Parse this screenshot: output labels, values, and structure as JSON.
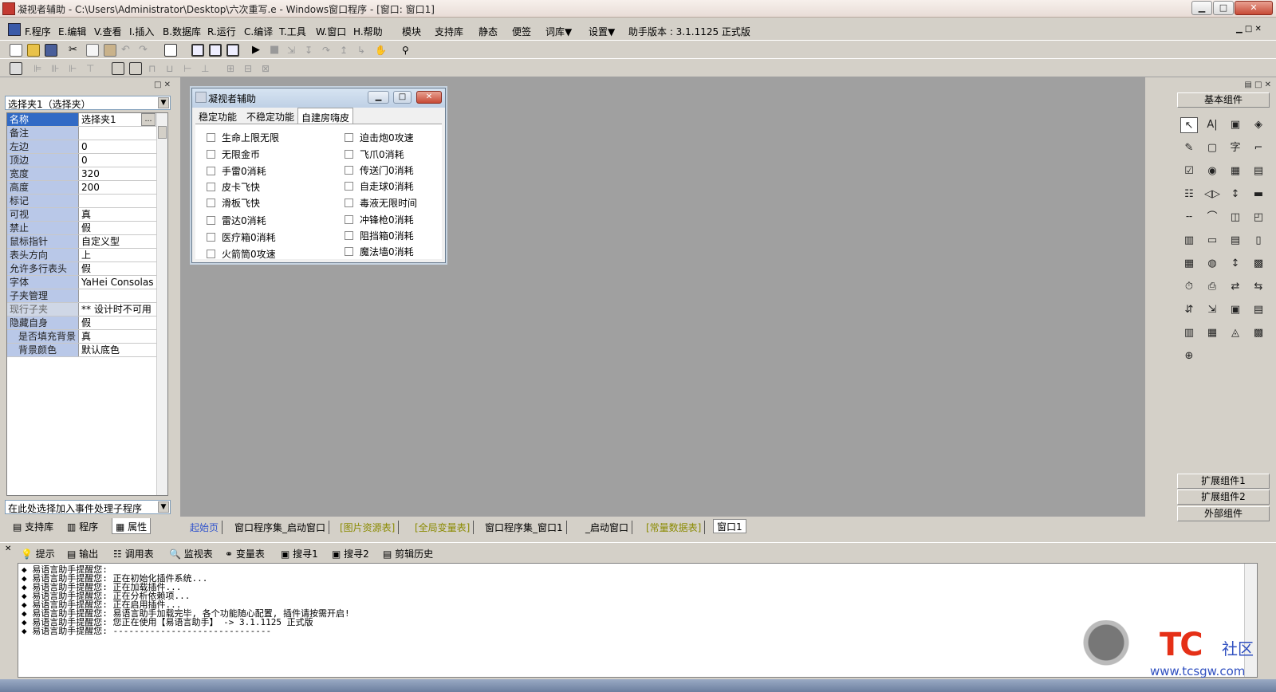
{
  "window": {
    "title": "凝视者辅助 - C:\\Users\\Administrator\\Desktop\\六次重写.e - Windows窗口程序 - [窗口: 窗口1]",
    "min": "▁",
    "max": "□",
    "close": "✕"
  },
  "menu": {
    "items": [
      "F.程序",
      "E.编辑",
      "V.查看",
      "I.插入",
      "B.数据库",
      "R.运行",
      "C.编译",
      "T.工具",
      "W.窗口",
      "H.帮助",
      "模块",
      "支持库",
      "静态",
      "便签",
      "词库▼",
      "设置▼"
    ],
    "version": "助手版本 : 3.1.1125 正式版"
  },
  "left_panel": {
    "selector": "选择夹1（选择夹）",
    "properties": [
      {
        "name": "名称",
        "value": "选择夹1",
        "selected": true
      },
      {
        "name": "备注",
        "value": ""
      },
      {
        "name": "左边",
        "value": "0"
      },
      {
        "name": "顶边",
        "value": "0"
      },
      {
        "name": "宽度",
        "value": "320"
      },
      {
        "name": "高度",
        "value": "200"
      },
      {
        "name": "标记",
        "value": ""
      },
      {
        "name": "可视",
        "value": "真"
      },
      {
        "name": "禁止",
        "value": "假"
      },
      {
        "name": "鼠标指针",
        "value": "自定义型"
      },
      {
        "name": "表头方向",
        "value": "上"
      },
      {
        "name": "允许多行表头",
        "value": "假"
      },
      {
        "name": "字体",
        "value": "YaHei Consolas H"
      },
      {
        "name": "子夹管理",
        "value": ""
      },
      {
        "name": "现行子夹",
        "value": "** 设计时不可用",
        "gray": true
      },
      {
        "name": "隐藏自身",
        "value": "假"
      },
      {
        "name": "是否填充背景",
        "value": "真",
        "sub": true
      },
      {
        "name": "背景颜色",
        "value": "默认底色",
        "sub": true
      }
    ],
    "event_combo": "在此处选择加入事件处理子程序",
    "tabs": [
      "支持库",
      "程序",
      "属性"
    ]
  },
  "dialog": {
    "title": "凝视者辅助",
    "tabs": [
      "稳定功能",
      "不稳定功能",
      "自建房嗨皮"
    ],
    "active_tab": 2,
    "left_checks": [
      "生命上限无限",
      "无限金币",
      "手雷0消耗",
      "皮卡飞快",
      "滑板飞快",
      "雷达0消耗",
      "医疗箱0消耗",
      "火箭筒0攻速"
    ],
    "right_checks": [
      "迫击炮0攻速",
      "飞爪0消耗",
      "传送门0消耗",
      "自走球0消耗",
      "毒液无限时间",
      "冲锋枪0消耗",
      "阻挡箱0消耗",
      "魔法墙0消耗"
    ]
  },
  "right_panel": {
    "header": "基本组件",
    "icons": [
      "↖",
      "A|",
      "▣",
      "◈",
      "✎",
      "▢",
      "字",
      "⌐",
      "☑",
      "◉",
      "▦",
      "▤",
      "☷",
      "◁▷",
      "↕",
      "▬",
      "╌",
      "⌒",
      "◫",
      "◰",
      "▥",
      "▭",
      "▤",
      "▯",
      "▦",
      "◍",
      "↕",
      "▩",
      "⏱",
      "⎙",
      "⇄",
      "⇆",
      "⇵",
      "⇲",
      "▣",
      "▤",
      "▥",
      "▦",
      "◬",
      "▩",
      "⊕"
    ],
    "buttons": [
      "扩展组件1",
      "扩展组件2",
      "外部组件"
    ]
  },
  "doc_tabs": [
    {
      "label": "起始页",
      "style": "blue"
    },
    {
      "label": "窗口程序集_启动窗口",
      "style": "normal"
    },
    {
      "label": "[图片资源表]",
      "style": "olive"
    },
    {
      "label": "[全局变量表]",
      "style": "olive"
    },
    {
      "label": "窗口程序集_窗口1",
      "style": "normal"
    },
    {
      "label": "_启动窗口",
      "style": "normal"
    },
    {
      "label": "[常量数据表]",
      "style": "olive"
    },
    {
      "label": "窗口1",
      "style": "active"
    }
  ],
  "output_tabs": [
    "提示",
    "输出",
    "调用表",
    "监视表",
    "变量表",
    "搜寻1",
    "搜寻2",
    "剪辑历史"
  ],
  "output_lines": [
    "◆ 易语言助手提醒您:",
    "◆ 易语言助手提醒您: 正在初始化插件系统...",
    "◆ 易语言助手提醒您: 正在加载插件...",
    "◆ 易语言助手提醒您: 正在分析依赖项...",
    "◆ 易语言助手提醒您: 正在启用插件...",
    "◆ 易语言助手提醒您: 易语言助手加载完毕, 各个功能随心配置, 插件请按需开启!",
    "◆ 易语言助手提醒您: 您正在使用【易语言助手】 -> 3.1.1125 正式版",
    "◆ 易语言助手提醒您: ------------------------------"
  ],
  "watermark": {
    "logo": "TC",
    "text": "社区",
    "url": "www.tcsgw.com"
  }
}
